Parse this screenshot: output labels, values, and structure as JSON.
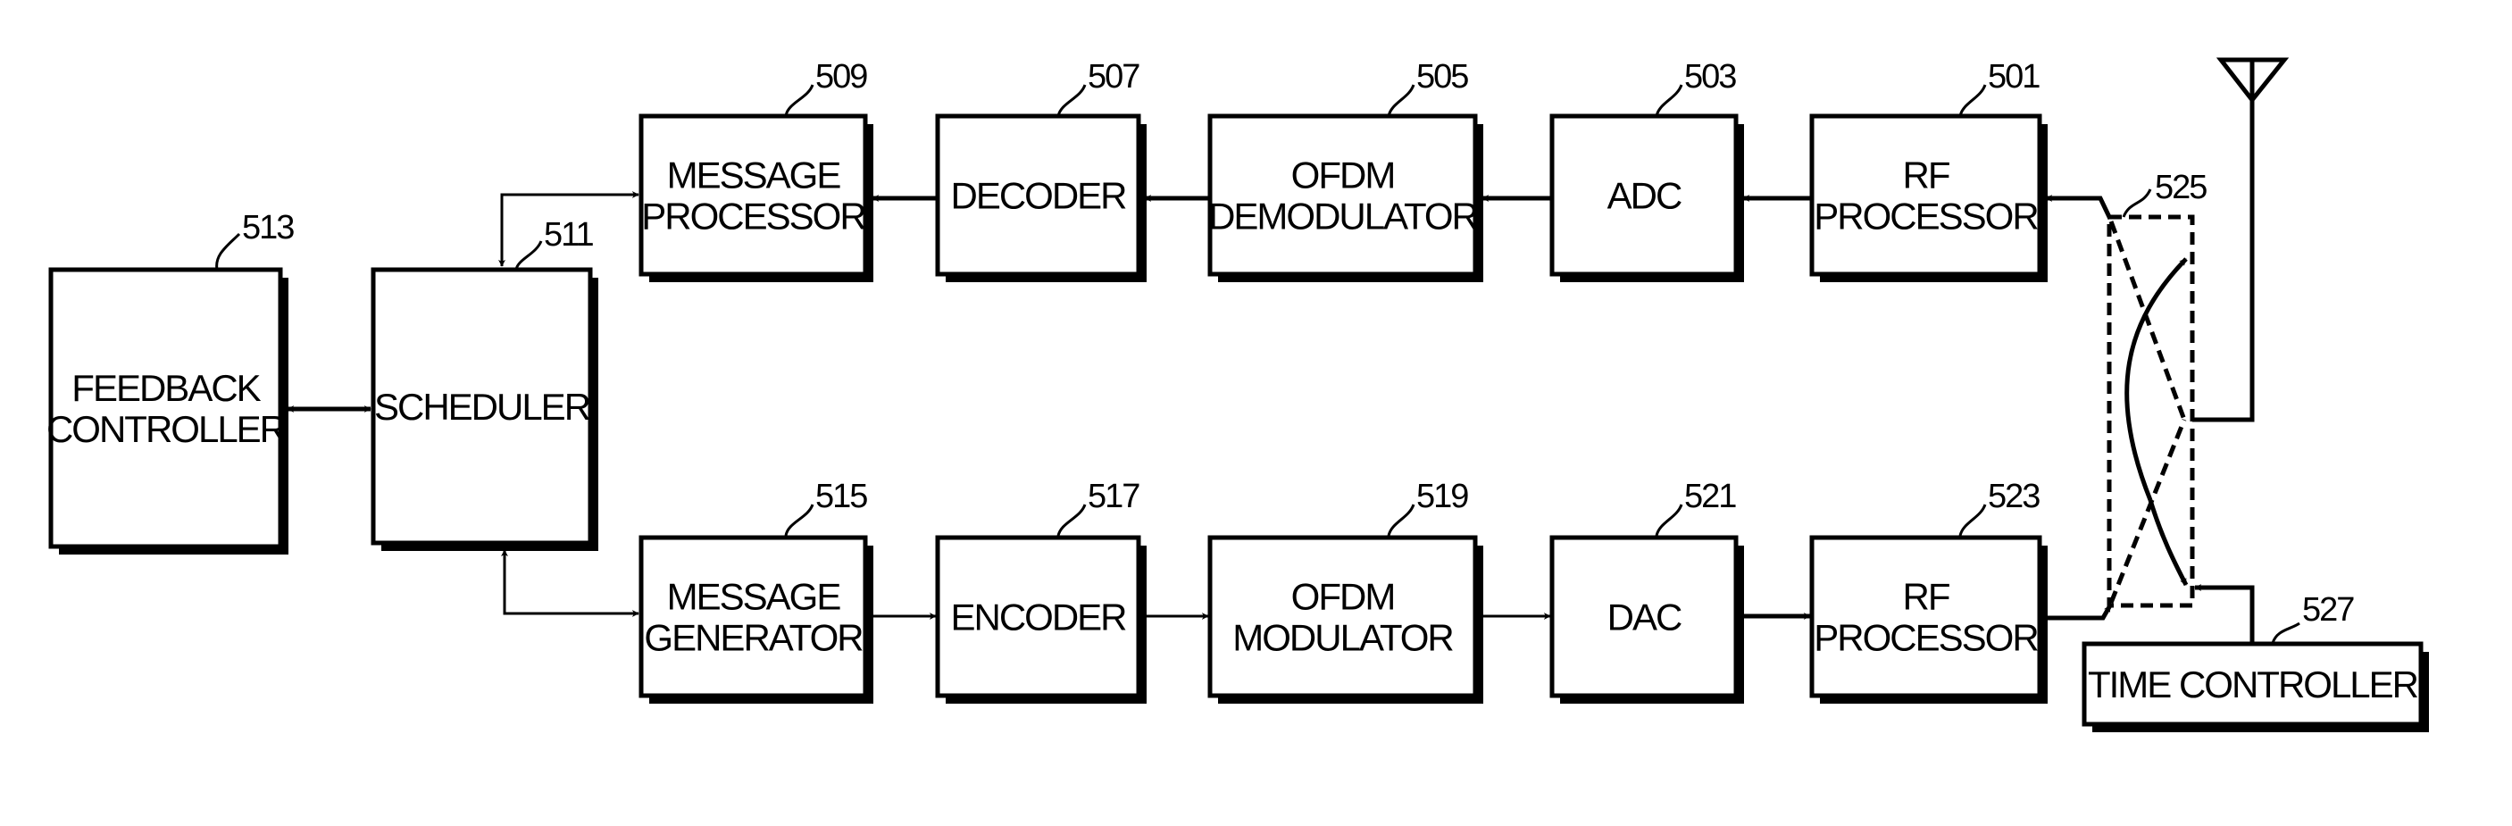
{
  "diagram": {
    "type": "block-diagram",
    "description": "OFDM transceiver block diagram",
    "blocks": [
      {
        "id": "rf_rx",
        "ref": "501",
        "lines": [
          "RF",
          "PROCESSOR"
        ]
      },
      {
        "id": "adc",
        "ref": "503",
        "lines": [
          "ADC"
        ]
      },
      {
        "id": "ofdm_demod",
        "ref": "505",
        "lines": [
          "OFDM",
          "DEMODULATOR"
        ]
      },
      {
        "id": "decoder",
        "ref": "507",
        "lines": [
          "DECODER"
        ]
      },
      {
        "id": "msg_proc",
        "ref": "509",
        "lines": [
          "MESSAGE",
          "PROCESSOR"
        ]
      },
      {
        "id": "scheduler",
        "ref": "511",
        "lines": [
          "SCHEDULER"
        ]
      },
      {
        "id": "feedback",
        "ref": "513",
        "lines": [
          "FEEDBACK",
          "CONTROLLER"
        ]
      },
      {
        "id": "msg_gen",
        "ref": "515",
        "lines": [
          "MESSAGE",
          "GENERATOR"
        ]
      },
      {
        "id": "encoder",
        "ref": "517",
        "lines": [
          "ENCODER"
        ]
      },
      {
        "id": "ofdm_mod",
        "ref": "519",
        "lines": [
          "OFDM",
          "MODULATOR"
        ]
      },
      {
        "id": "dac",
        "ref": "521",
        "lines": [
          "DAC"
        ]
      },
      {
        "id": "rf_tx",
        "ref": "523",
        "lines": [
          "RF",
          "PROCESSOR"
        ]
      },
      {
        "id": "time_ctrl",
        "ref": "527",
        "lines": [
          "TIME CONTROLLER"
        ]
      }
    ],
    "duplexer": {
      "id": "switch",
      "ref": "525"
    },
    "antenna": {
      "id": "antenna"
    },
    "connections": [
      {
        "from": "rf_rx",
        "to": "adc"
      },
      {
        "from": "adc",
        "to": "ofdm_demod"
      },
      {
        "from": "ofdm_demod",
        "to": "decoder"
      },
      {
        "from": "decoder",
        "to": "msg_proc"
      },
      {
        "from": "msg_proc",
        "to": "scheduler",
        "bidirectional": true
      },
      {
        "from": "feedback",
        "to": "scheduler",
        "bidirectional": true
      },
      {
        "from": "scheduler",
        "to": "msg_gen",
        "bidirectional": true
      },
      {
        "from": "msg_gen",
        "to": "encoder"
      },
      {
        "from": "encoder",
        "to": "ofdm_mod"
      },
      {
        "from": "ofdm_mod",
        "to": "dac"
      },
      {
        "from": "dac",
        "to": "rf_tx"
      },
      {
        "from": "rf_tx",
        "to": "switch"
      },
      {
        "from": "switch",
        "to": "rf_rx"
      },
      {
        "from": "switch",
        "to": "antenna",
        "bidirectional": true
      },
      {
        "from": "time_ctrl",
        "to": "switch"
      }
    ]
  }
}
